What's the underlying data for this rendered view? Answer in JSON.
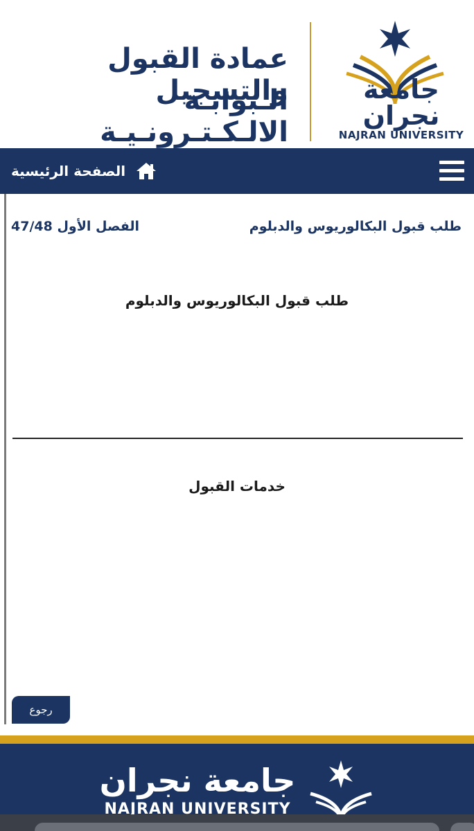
{
  "header": {
    "title_line1": "عمادة القبول والتسجيل",
    "title_line2": "الـبوابـة الالـكـتـرونـيـة",
    "logo_ar": "جامعة نجران",
    "logo_en": "NAJRAN UNIVERSITY"
  },
  "nav": {
    "home_label": "الصفحة الرئيسية",
    "menu_icon": "hamburger-icon",
    "home_icon": "home-icon"
  },
  "info": {
    "page_name": "طلب قبول البكالوريوس والدبلوم",
    "semester": "الفصل الأول 47/48"
  },
  "content": {
    "section1_title": "طلب قبول البكالوريوس والدبلوم",
    "section2_title": "خدمات القبول",
    "back_label": "رجوع"
  },
  "footer": {
    "logo_ar": "جامعة نجران",
    "logo_en": "NAJRAN UNIVERSITY"
  },
  "colors": {
    "primary": "#1b3461",
    "gold": "#d6a21e"
  }
}
